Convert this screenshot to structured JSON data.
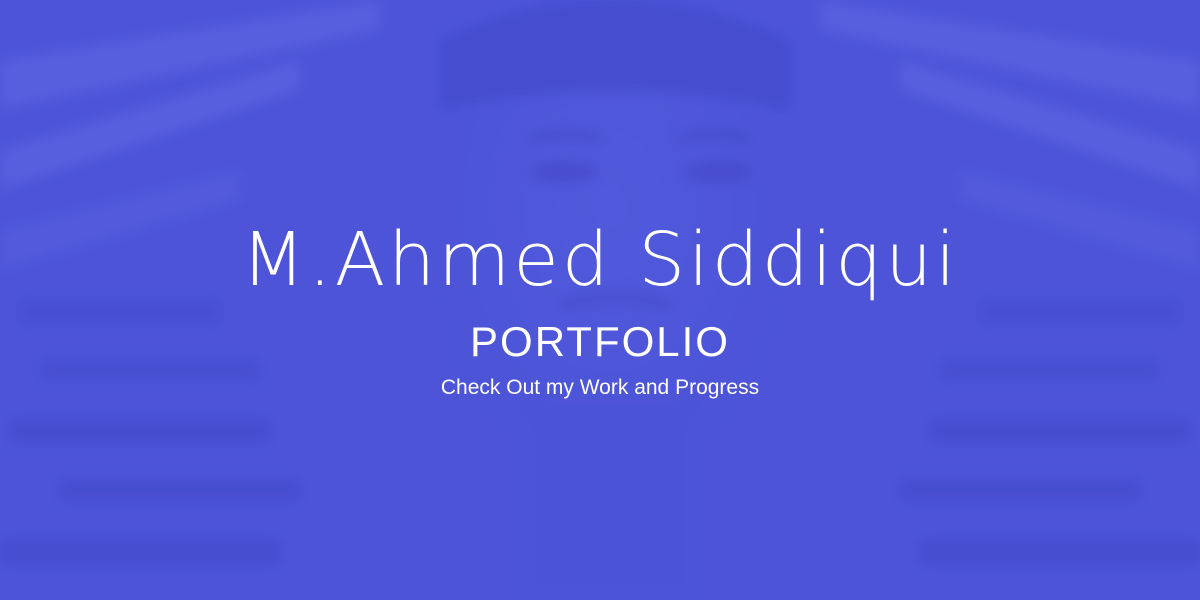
{
  "banner": {
    "name": "M.Ahmed Siddiqui",
    "title": "PORTFOLIO",
    "tagline": "Check Out my Work and Progress"
  },
  "colors": {
    "background": "#4e55d6",
    "text": "#ffffff"
  }
}
